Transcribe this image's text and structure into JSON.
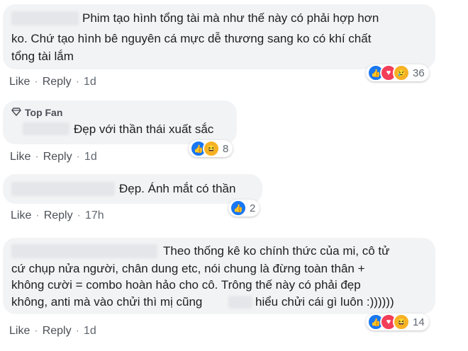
{
  "comments": [
    {
      "text": "Phim tạo hình tổng tài mà như thế này có phải hợp hơn ko. Chứ tạo hình bê nguyên cá mực dễ thương sang ko có khí chất tổng tài lắm",
      "line1": "Phim tạo hình tổng tài mà như thế này có phải hợp hơn",
      "line2": "ko. Chứ tạo hình bê nguyên cá mực dễ thương sang ko có khí chất",
      "line3": "tổng tài lắm",
      "like_label": "Like",
      "reply_label": "Reply",
      "time": "1d",
      "reaction_icons": [
        "like-icon",
        "love-icon",
        "sad-icon"
      ],
      "reaction_count": "36"
    },
    {
      "badge": "Top Fan",
      "badge_icon": "diamond-icon",
      "text": "Đẹp với thần thái xuất sắc",
      "like_label": "Like",
      "reply_label": "Reply",
      "time": "1d",
      "reaction_icons": [
        "like-icon",
        "haha-icon"
      ],
      "reaction_count": "8"
    },
    {
      "text": "Đẹp. Ánh mắt có thần",
      "like_label": "Like",
      "reply_label": "Reply",
      "time": "17h",
      "reaction_icons": [
        "like-icon"
      ],
      "reaction_count": "2"
    },
    {
      "line1": "Theo thống kê ko chính thức của mi, cô tử",
      "line2": "cứ chụp nửa người, chân dung etc, nói chung là đừng toàn thân +",
      "line3": "không cười = combo hoàn hảo cho cô. Trông thế này có phải đẹp",
      "line4a": "không, anti mà vào chửi thì mị cũng",
      "line4b": "hiểu chửi cái gì luôn :))))))",
      "like_label": "Like",
      "reply_label": "Reply",
      "time": "1d",
      "reaction_icons": [
        "like-icon",
        "love-icon",
        "haha-icon"
      ],
      "reaction_count": "14"
    }
  ],
  "separator": "·",
  "colors": {
    "bubble": "#f2f3f5",
    "like": "#1877f2",
    "love": "#f33e58",
    "sad_haha": "#f7b125",
    "meta": "#606770"
  }
}
